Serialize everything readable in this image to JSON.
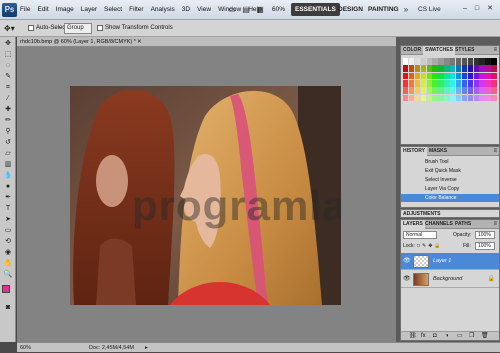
{
  "app": {
    "logo": "Ps"
  },
  "menubar": {
    "items": [
      "File",
      "Edit",
      "Image",
      "Layer",
      "Select",
      "Filter",
      "Analysis",
      "3D",
      "View",
      "Window",
      "Help"
    ],
    "zoom": "60%",
    "workspaces": [
      "ESSENTIALS",
      "DESIGN",
      "PAINTING"
    ],
    "cslive": "CS Live",
    "icons": [
      "bridge-icon",
      "mini-bridge-icon",
      "arrange-icon",
      "screen-mode-icon"
    ]
  },
  "options": {
    "auto_select_label": "Auto-Select:",
    "auto_select_value": "Group",
    "transform_label": "Show Transform Controls"
  },
  "document": {
    "tab_title": "rhdc10b.bmp @ 60% (Layer 1, RGB/8/CMYK) *",
    "watermark": "programlar.com"
  },
  "statusbar": {
    "zoom": "60%",
    "doc": "Doc: 2,45M/4,54M"
  },
  "panels": {
    "color": {
      "tabs": [
        "COLOR",
        "SWATCHES",
        "STYLES"
      ],
      "active": 1
    },
    "history": {
      "tabs": [
        "HISTORY",
        "MASKS"
      ],
      "items": [
        "Brush Tool",
        "Exit Quick Mask",
        "Select Inverse",
        "Layer Via Copy",
        "Color Balance"
      ],
      "selected": 4
    },
    "adjustments": {
      "label": "ADJUSTMENTS"
    },
    "layers": {
      "tabs": [
        "LAYERS",
        "CHANNELS",
        "PATHS"
      ],
      "blend": "Normal",
      "opacity_label": "Opacity:",
      "opacity": "100%",
      "lock_label": "Lock:",
      "fill_label": "Fill:",
      "fill": "100%",
      "items": [
        {
          "name": "Layer 1",
          "selected": true
        },
        {
          "name": "Background",
          "selected": false
        }
      ]
    }
  },
  "colors": {
    "accent": "#4a88d8",
    "foreground_swatch": "#e8318c",
    "background_swatch": "#ffffff"
  }
}
